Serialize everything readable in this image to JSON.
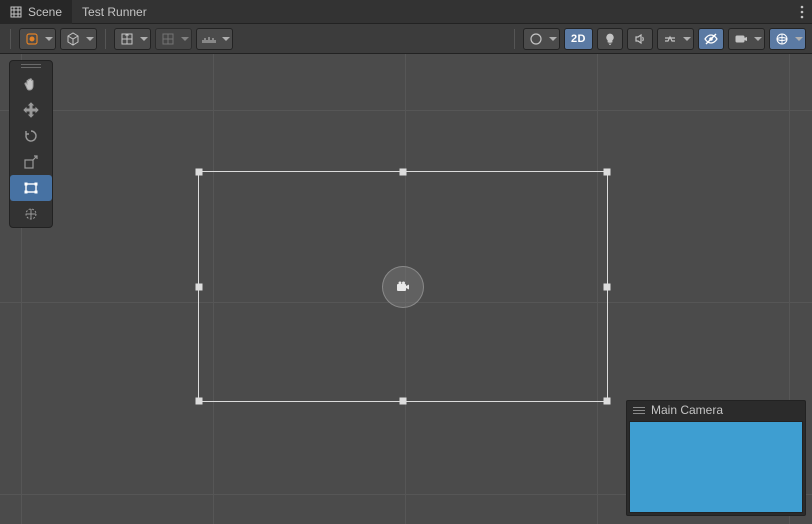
{
  "tabs": [
    {
      "label": "Scene",
      "active": true
    },
    {
      "label": "Test Runner",
      "active": false
    }
  ],
  "toolbar": {
    "twod_label": "2D"
  },
  "camera_preview": {
    "title": "Main Camera",
    "color": "#3e9ed1"
  }
}
